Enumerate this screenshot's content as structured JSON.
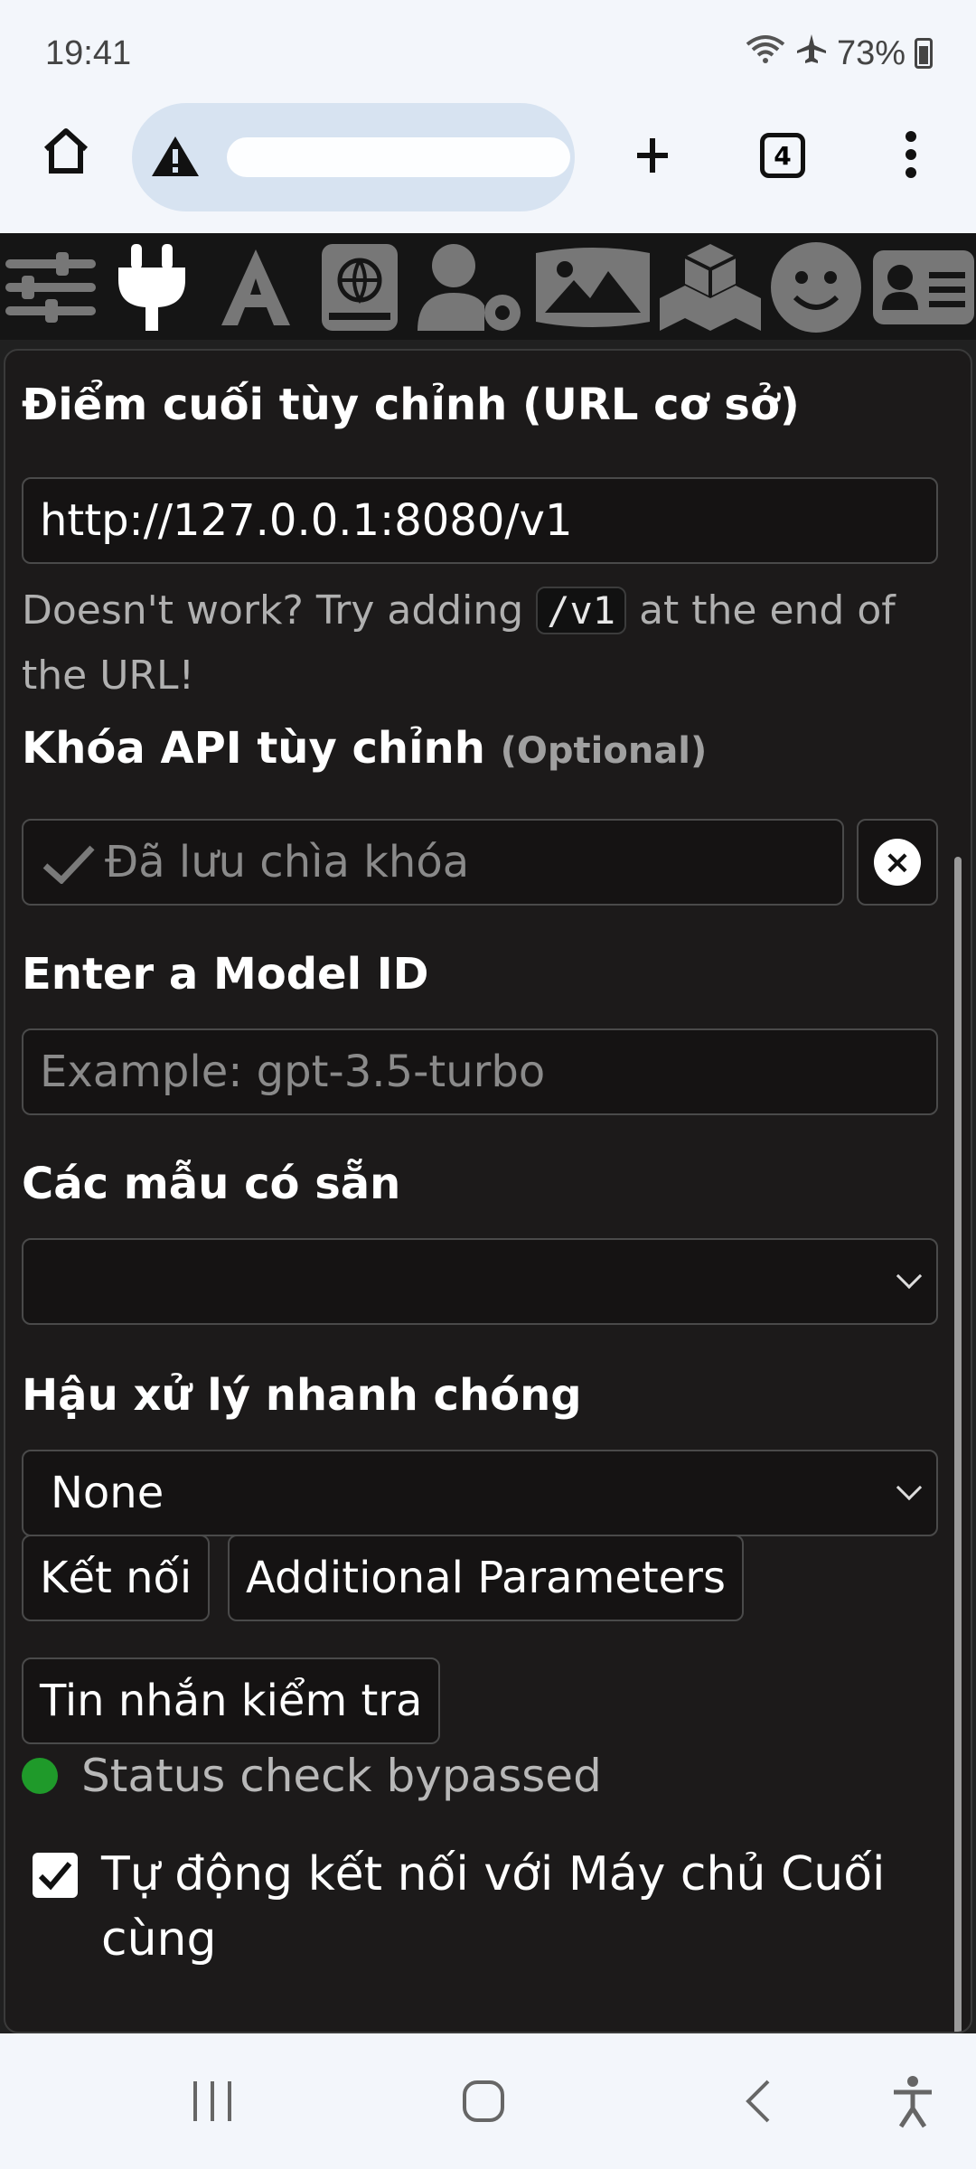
{
  "status_bar": {
    "time": "19:41",
    "battery": "73%"
  },
  "browser": {
    "tab_count": "4"
  },
  "form": {
    "endpoint_label": "Điểm cuối tùy chỉnh (URL cơ sở)",
    "endpoint_value": "http://127.0.0.1:8080/v1",
    "hint_before": "Doesn't work? Try adding ",
    "hint_code": "/v1",
    "hint_after": " at the end of the URL!",
    "api_key_label": "Khóa API tùy chỉnh",
    "api_key_optional": "(Optional)",
    "api_key_placeholder": "Đã lưu chìa khóa",
    "model_id_label": "Enter a Model ID",
    "model_id_placeholder": "Example: gpt-3.5-turbo",
    "available_models_label": "Các mẫu có sẵn",
    "available_models_value": "",
    "postprocess_label": "Hậu xử lý nhanh chóng",
    "postprocess_value": "None",
    "connect_button": "Kết nối",
    "additional_params_button": "Additional Parameters",
    "test_message_button": "Tin nhắn kiểm tra",
    "status_text": "Status check bypassed",
    "auto_connect_label": "Tự động kết nối với Máy chủ Cuối cùng",
    "auto_connect_checked": true
  },
  "colors": {
    "status_dot": "#1f9a2a",
    "panel_bg": "#1c1a1a"
  }
}
